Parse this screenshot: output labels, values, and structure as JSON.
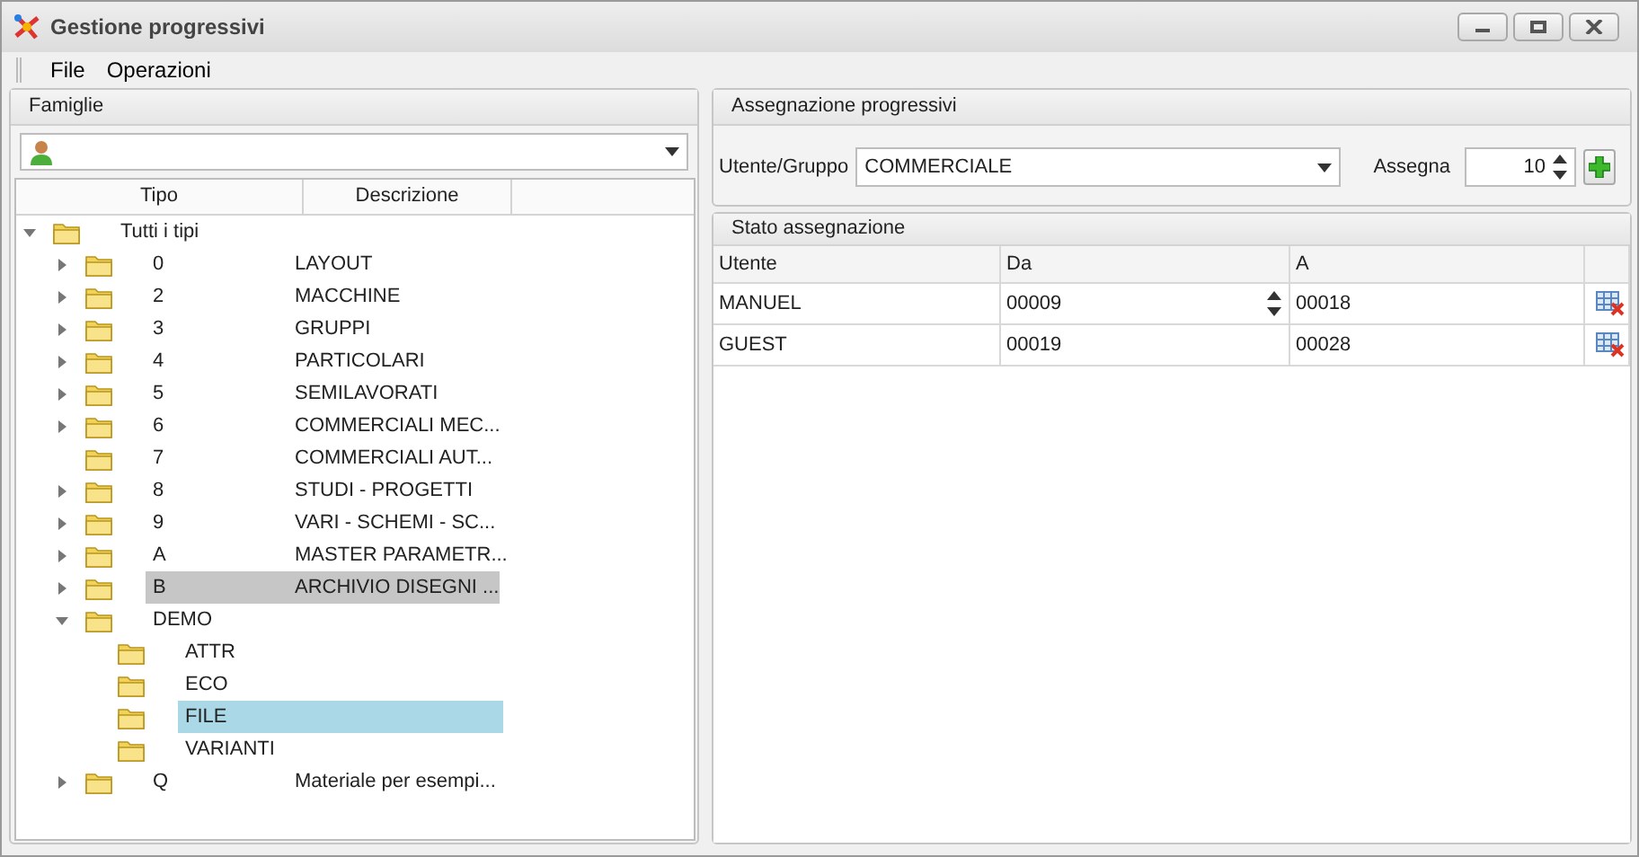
{
  "window": {
    "title": "Gestione progressivi"
  },
  "menu": [
    "File",
    "Operazioni"
  ],
  "famiglie": {
    "title": "Famiglie",
    "columns": [
      "Tipo",
      "Descrizione"
    ],
    "tree": [
      {
        "tipo": "Tutti i tipi",
        "expanded": true,
        "selected": false,
        "children": [
          {
            "tipo": "0",
            "descrizione": "LAYOUT",
            "expanded": false,
            "selected": false
          },
          {
            "tipo": "2",
            "descrizione": "MACCHINE",
            "expanded": false,
            "selected": false
          },
          {
            "tipo": "3",
            "descrizione": "GRUPPI",
            "expanded": false,
            "selected": false
          },
          {
            "tipo": "4",
            "descrizione": "PARTICOLARI",
            "expanded": false,
            "selected": false
          },
          {
            "tipo": "5",
            "descrizione": "SEMILAVORATI",
            "expanded": false,
            "selected": false
          },
          {
            "tipo": "6",
            "descrizione": "COMMERCIALI MEC...",
            "expanded": false,
            "selected": false
          },
          {
            "tipo": "7",
            "descrizione": "COMMERCIALI AUT...",
            "selected": false
          },
          {
            "tipo": "8",
            "descrizione": "STUDI - PROGETTI",
            "expanded": false,
            "selected": false
          },
          {
            "tipo": "9",
            "descrizione": "VARI - SCHEMI - SC...",
            "expanded": false,
            "selected": false
          },
          {
            "tipo": "A",
            "descrizione": "MASTER PARAMETR...",
            "expanded": false,
            "selected": false
          },
          {
            "tipo": "B",
            "descrizione": "ARCHIVIO DISEGNI ...",
            "expanded": false,
            "selected": false,
            "focused": true
          },
          {
            "tipo": "DEMO",
            "expanded": true,
            "selected": false,
            "children": [
              {
                "tipo": "ATTR",
                "selected": false
              },
              {
                "tipo": "ECO",
                "selected": false
              },
              {
                "tipo": "FILE",
                "selected": true
              },
              {
                "tipo": "VARIANTI",
                "selected": false
              }
            ]
          },
          {
            "tipo": "Q",
            "descrizione": "Materiale per esempi...",
            "expanded": false,
            "selected": false
          }
        ]
      }
    ]
  },
  "assegnazione": {
    "title": "Assegnazione progressivi",
    "utente_label": "Utente/Gruppo",
    "utente_value": "COMMERCIALE",
    "assegna_label": "Assegna",
    "assegna_value": "10"
  },
  "stato": {
    "title": "Stato assegnazione",
    "columns": [
      "Utente",
      "Da",
      "A"
    ],
    "rows": [
      {
        "utente": "MANUEL",
        "da": "00009",
        "a": "00018",
        "editing": true
      },
      {
        "utente": "GUEST",
        "da": "00019",
        "a": "00028",
        "editing": false
      }
    ]
  }
}
